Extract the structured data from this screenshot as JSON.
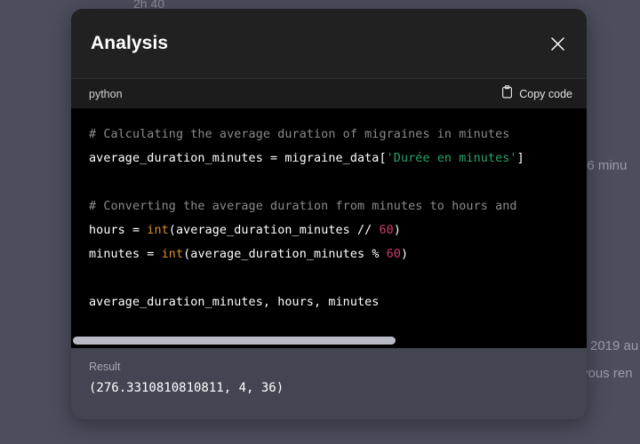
{
  "background": {
    "top_fragment": "2h 40",
    "right_fragment_1": "36 minu",
    "right_fragment_2": "2019 au",
    "right_fragment_3": "vous ren"
  },
  "modal": {
    "title": "Analysis",
    "close_icon": "close-icon",
    "toolbar": {
      "language": "python",
      "copy_label": "Copy code",
      "copy_icon": "clipboard-icon"
    },
    "code": {
      "lines": [
        [
          {
            "t": "# Calculating the average duration of migraines in minutes",
            "c": "comment"
          }
        ],
        [
          {
            "t": "average_duration_minutes = migraine_data[",
            "c": "plain"
          },
          {
            "t": "'Durée en minutes'",
            "c": "string"
          },
          {
            "t": "]",
            "c": "plain"
          }
        ],
        [],
        [
          {
            "t": "# Converting the average duration from minutes to hours and",
            "c": "comment"
          }
        ],
        [
          {
            "t": "hours = ",
            "c": "plain"
          },
          {
            "t": "int",
            "c": "builtin"
          },
          {
            "t": "(average_duration_minutes // ",
            "c": "plain"
          },
          {
            "t": "60",
            "c": "number"
          },
          {
            "t": ")",
            "c": "plain"
          }
        ],
        [
          {
            "t": "minutes = ",
            "c": "plain"
          },
          {
            "t": "int",
            "c": "builtin"
          },
          {
            "t": "(average_duration_minutes % ",
            "c": "plain"
          },
          {
            "t": "60",
            "c": "number"
          },
          {
            "t": ")",
            "c": "plain"
          }
        ],
        [],
        [
          {
            "t": "average_duration_minutes, hours, minutes",
            "c": "plain"
          }
        ]
      ]
    },
    "result": {
      "label": "Result",
      "value": "(276.3310810810811, 4, 36)"
    }
  },
  "colors": {
    "page_background": "#4c4e5e",
    "modal_header": "#212121",
    "code_background": "#000000",
    "result_background": "#434553",
    "string_green": "#29a36a",
    "builtin_orange": "#d79029",
    "number_pink": "#d6396b",
    "comment_gray": "#8b8b8b"
  }
}
